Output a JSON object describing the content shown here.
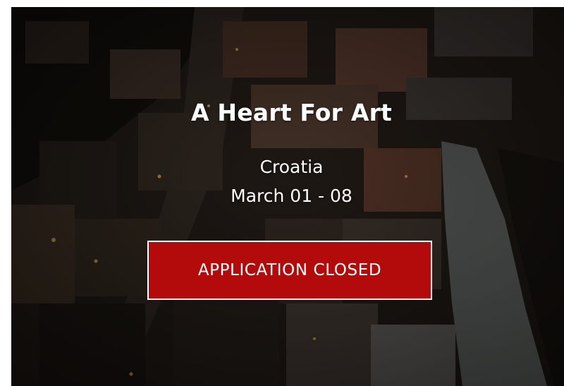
{
  "event": {
    "title": "A Heart For Art",
    "location": "Croatia",
    "dates": "March 01 - 08"
  },
  "cta": {
    "label": "APPLICATION CLOSED",
    "color": "#b30b0b"
  },
  "background": {
    "image": "aerial-city-river-photo"
  }
}
